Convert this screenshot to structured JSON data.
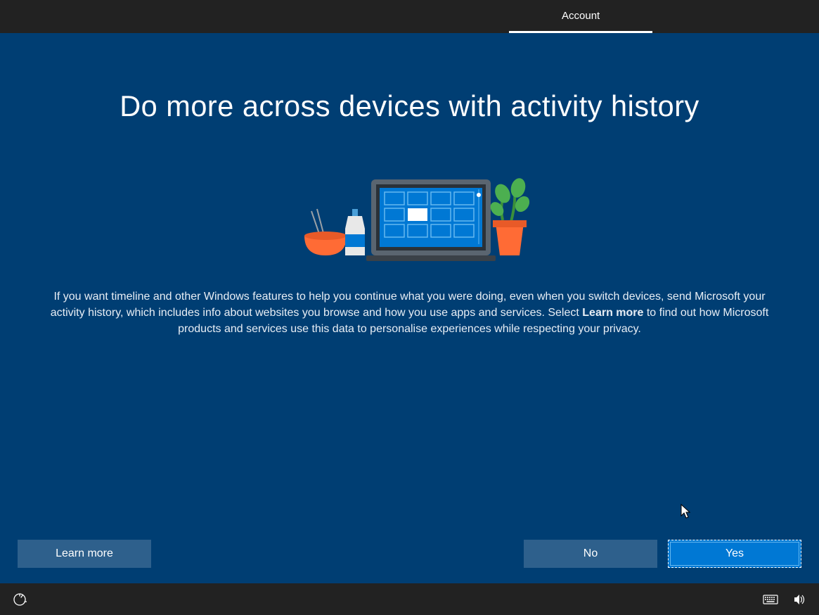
{
  "header": {
    "tab_label": "Account"
  },
  "main": {
    "heading": "Do more across devices with activity history",
    "description_part1": "If you want timeline and other Windows features to help you continue what you were doing, even when you switch devices, send Microsoft your activity history, which includes info about websites you browse and how you use apps and services. Select ",
    "description_bold": "Learn more",
    "description_part2": " to find out how Microsoft products and services use this data to personalise experiences while respecting your privacy."
  },
  "buttons": {
    "learn_more": "Learn more",
    "no": "No",
    "yes": "Yes"
  }
}
